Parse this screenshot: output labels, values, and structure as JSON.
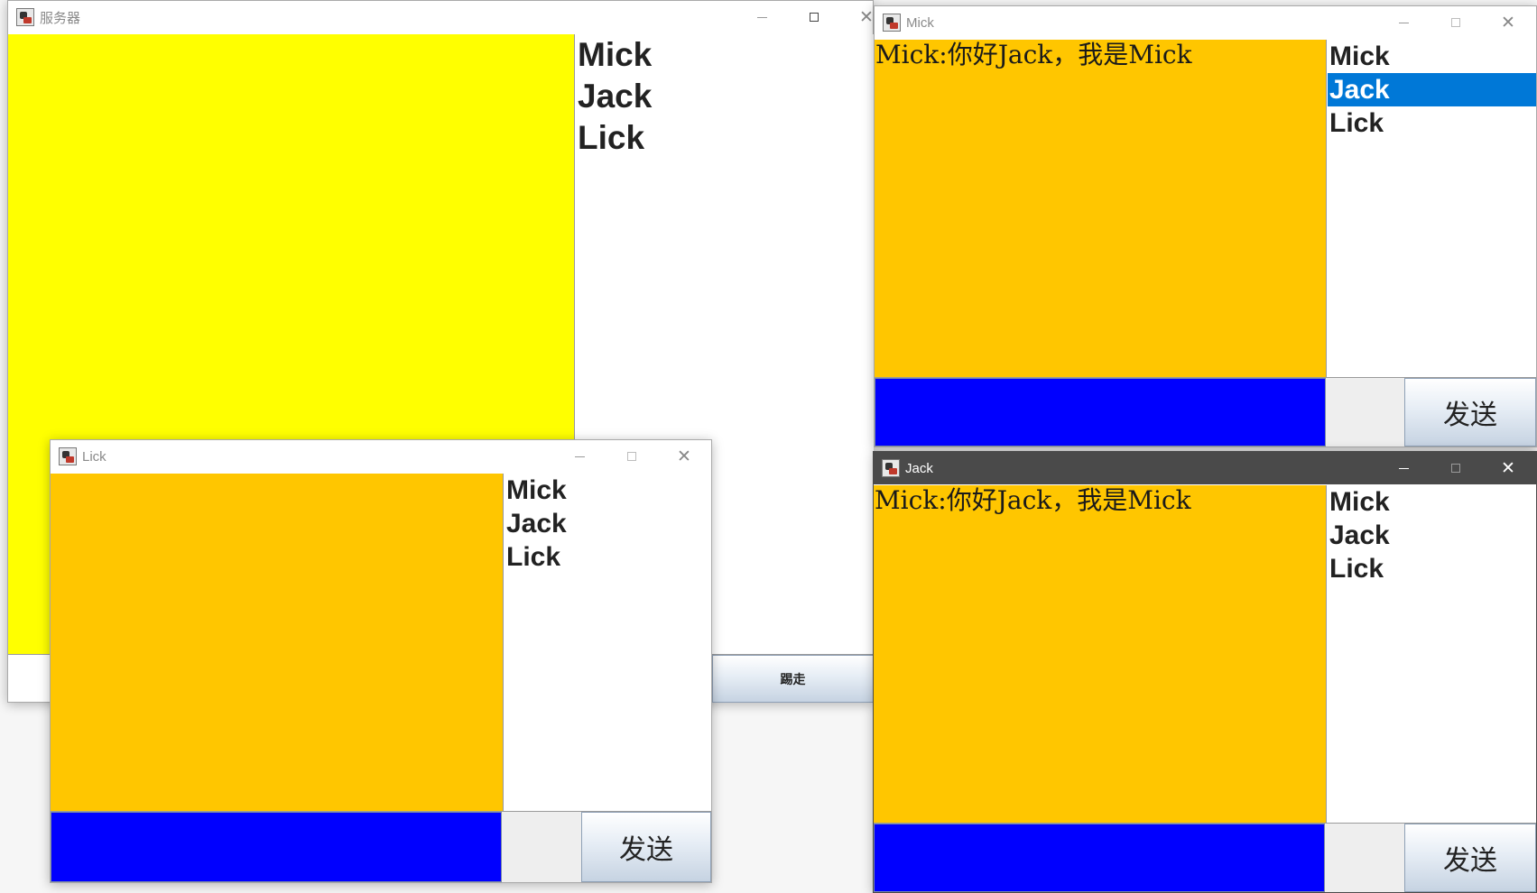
{
  "server": {
    "title": "服务器",
    "users": [
      "Mick",
      "Jack",
      "Lick"
    ],
    "kick_label": "踢走"
  },
  "lick": {
    "title": "Lick",
    "users": [
      "Mick",
      "Jack",
      "Lick"
    ],
    "send_label": "发送"
  },
  "mick": {
    "title": "Mick",
    "message": "Mick:你好Jack，我是Mick",
    "users": [
      "Mick",
      "Jack",
      "Lick"
    ],
    "selected_user": "Jack",
    "send_label": "发送"
  },
  "jack": {
    "title": "Jack",
    "message": "Mick:你好Jack，我是Mick",
    "users": [
      "Mick",
      "Jack",
      "Lick"
    ],
    "send_label": "发送"
  },
  "colors": {
    "server_message_area": "#ffff00",
    "client_message_area": "#ffc600",
    "input_field": "#0000ff",
    "selection": "#0078d7"
  }
}
